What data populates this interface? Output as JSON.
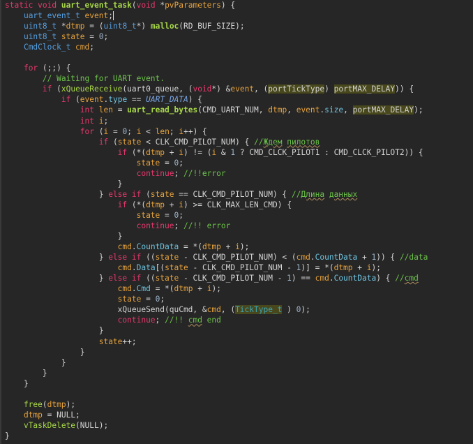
{
  "editor": {
    "lines": [
      [
        [
          "k",
          "static void "
        ],
        [
          "fb",
          "uart_event_task"
        ],
        [
          "p",
          "("
        ],
        [
          "k",
          "void "
        ],
        [
          "p",
          "*"
        ],
        [
          "v",
          "pvParameters"
        ],
        [
          "p",
          ") {"
        ]
      ],
      [
        [
          "p",
          "    "
        ],
        [
          "t",
          "uart_event_t "
        ],
        [
          "v",
          "event"
        ],
        [
          "p",
          "; cursor"
        ]
      ],
      [
        [
          "p",
          "    "
        ],
        [
          "t",
          "uint8_t "
        ],
        [
          "p",
          "*"
        ],
        [
          "v",
          "dtmp"
        ],
        [
          "p",
          " = ("
        ],
        [
          "t",
          "uint8_t"
        ],
        [
          "p",
          "*) "
        ],
        [
          "fb",
          "malloc"
        ],
        [
          "p",
          "(RD_BUF_SIZE);"
        ]
      ],
      [
        [
          "p",
          "    "
        ],
        [
          "t",
          "uint8_t "
        ],
        [
          "v",
          "state"
        ],
        [
          "p",
          " = "
        ],
        [
          "n",
          "0"
        ],
        [
          "p",
          ";"
        ]
      ],
      [
        [
          "p",
          "    "
        ],
        [
          "t",
          "CmdClock_t "
        ],
        [
          "v",
          "cmd"
        ],
        [
          "p",
          ";"
        ]
      ],
      [],
      [
        [
          "p",
          "    "
        ],
        [
          "k",
          "for"
        ],
        [
          "p",
          " (;;) {"
        ]
      ],
      [
        [
          "p",
          "        "
        ],
        [
          "c",
          "// Waiting for UART event."
        ]
      ],
      [
        [
          "p",
          "        "
        ],
        [
          "k",
          "if"
        ],
        [
          "p",
          " ("
        ],
        [
          "f",
          "xQueueReceive"
        ],
        [
          "p",
          "(uart0_queue, ("
        ],
        [
          "k",
          "void"
        ],
        [
          "p",
          "*) &"
        ],
        [
          "v",
          "event"
        ],
        [
          "p",
          ", ("
        ],
        [
          "h",
          "portTickType"
        ],
        [
          "p",
          ") "
        ],
        [
          "h",
          "portMAX_DELAY"
        ],
        [
          "p",
          ")) {"
        ]
      ],
      [
        [
          "p",
          "            "
        ],
        [
          "k",
          "if"
        ],
        [
          "p",
          " ("
        ],
        [
          "v",
          "event"
        ],
        [
          "p",
          "."
        ],
        [
          "fld",
          "type"
        ],
        [
          "p",
          " == "
        ],
        [
          "e",
          "UART_DATA"
        ],
        [
          "p",
          ") {"
        ]
      ],
      [
        [
          "p",
          "                "
        ],
        [
          "k",
          "int "
        ],
        [
          "v",
          "len"
        ],
        [
          "p",
          " = "
        ],
        [
          "fb",
          "uart_read_bytes"
        ],
        [
          "p",
          "(CMD_UART_NUM, "
        ],
        [
          "v",
          "dtmp"
        ],
        [
          "p",
          ", "
        ],
        [
          "v",
          "event"
        ],
        [
          "p",
          "."
        ],
        [
          "fld",
          "size"
        ],
        [
          "p",
          ", "
        ],
        [
          "h",
          "portMAX_DELAY"
        ],
        [
          "p",
          ");"
        ]
      ],
      [
        [
          "p",
          "                "
        ],
        [
          "k",
          "int "
        ],
        [
          "v",
          "i"
        ],
        [
          "p",
          ";"
        ]
      ],
      [
        [
          "p",
          "                "
        ],
        [
          "k",
          "for"
        ],
        [
          "p",
          " ("
        ],
        [
          "v",
          "i"
        ],
        [
          "p",
          " = "
        ],
        [
          "n",
          "0"
        ],
        [
          "p",
          "; "
        ],
        [
          "v",
          "i"
        ],
        [
          "p",
          " < "
        ],
        [
          "v",
          "len"
        ],
        [
          "p",
          "; "
        ],
        [
          "v",
          "i"
        ],
        [
          "p",
          "++) {"
        ]
      ],
      [
        [
          "p",
          "                    "
        ],
        [
          "k",
          "if"
        ],
        [
          "p",
          " ("
        ],
        [
          "v",
          "state"
        ],
        [
          "p",
          " < CLK_CMD_PILOT_NUM) { "
        ],
        [
          "c",
          "//"
        ],
        [
          "c sq",
          "Ждем"
        ],
        [
          "c",
          " "
        ],
        [
          "c sq",
          "пилотов"
        ]
      ],
      [
        [
          "p",
          "                        "
        ],
        [
          "k",
          "if"
        ],
        [
          "p",
          " (*("
        ],
        [
          "v",
          "dtmp"
        ],
        [
          "p",
          " + "
        ],
        [
          "v",
          "i"
        ],
        [
          "p",
          ") != ("
        ],
        [
          "v",
          "i"
        ],
        [
          "p",
          " & "
        ],
        [
          "n",
          "1"
        ],
        [
          "p",
          " ? CMD_CLCK_PILOT1 : CMD_CLCK_PILOT2)) {"
        ]
      ],
      [
        [
          "p",
          "                            "
        ],
        [
          "v",
          "state"
        ],
        [
          "p",
          " = "
        ],
        [
          "n",
          "0"
        ],
        [
          "p",
          ";"
        ]
      ],
      [
        [
          "p",
          "                            "
        ],
        [
          "k",
          "continue"
        ],
        [
          "p",
          "; "
        ],
        [
          "c",
          "//!!error"
        ]
      ],
      [
        [
          "p",
          "                        }"
        ]
      ],
      [
        [
          "p",
          "                    } "
        ],
        [
          "k",
          "else if"
        ],
        [
          "p",
          " ("
        ],
        [
          "v",
          "state"
        ],
        [
          "p",
          " == CLK_CMD_PILOT_NUM) { "
        ],
        [
          "c",
          "//"
        ],
        [
          "c sq",
          "Длина"
        ],
        [
          "c",
          " "
        ],
        [
          "c sq",
          "данных"
        ]
      ],
      [
        [
          "p",
          "                        "
        ],
        [
          "k",
          "if"
        ],
        [
          "p",
          " (*("
        ],
        [
          "v",
          "dtmp"
        ],
        [
          "p",
          " + "
        ],
        [
          "v",
          "i"
        ],
        [
          "p",
          ") >= CLK_MAX_LEN_CMD) {"
        ]
      ],
      [
        [
          "p",
          "                            "
        ],
        [
          "v",
          "state"
        ],
        [
          "p",
          " = "
        ],
        [
          "n",
          "0"
        ],
        [
          "p",
          ";"
        ]
      ],
      [
        [
          "p",
          "                            "
        ],
        [
          "k",
          "continue"
        ],
        [
          "p",
          "; "
        ],
        [
          "c",
          "//!! error"
        ]
      ],
      [
        [
          "p",
          "                        }"
        ]
      ],
      [
        [
          "p",
          "                        "
        ],
        [
          "v",
          "cmd"
        ],
        [
          "p",
          "."
        ],
        [
          "fld",
          "CountData"
        ],
        [
          "p",
          " = *("
        ],
        [
          "v",
          "dtmp"
        ],
        [
          "p",
          " + "
        ],
        [
          "v",
          "i"
        ],
        [
          "p",
          ");"
        ]
      ],
      [
        [
          "p",
          "                    } "
        ],
        [
          "k",
          "else if"
        ],
        [
          "p",
          " (("
        ],
        [
          "v",
          "state"
        ],
        [
          "p",
          " - CLK_CMD_PILOT_NUM) < ("
        ],
        [
          "v",
          "cmd"
        ],
        [
          "p",
          "."
        ],
        [
          "fld",
          "CountData"
        ],
        [
          "p",
          " + "
        ],
        [
          "n",
          "1"
        ],
        [
          "p",
          ")) { "
        ],
        [
          "c",
          "//data"
        ]
      ],
      [
        [
          "p",
          "                        "
        ],
        [
          "v",
          "cmd"
        ],
        [
          "p",
          "."
        ],
        [
          "fld",
          "Data"
        ],
        [
          "p",
          "[("
        ],
        [
          "v",
          "state"
        ],
        [
          "p",
          " - CLK_CMD_PILOT_NUM - "
        ],
        [
          "n",
          "1"
        ],
        [
          "p",
          ")] = *("
        ],
        [
          "v",
          "dtmp"
        ],
        [
          "p",
          " + "
        ],
        [
          "v",
          "i"
        ],
        [
          "p",
          ");"
        ]
      ],
      [
        [
          "p",
          "                    } "
        ],
        [
          "k",
          "else if"
        ],
        [
          "p",
          " (("
        ],
        [
          "v",
          "state"
        ],
        [
          "p",
          " - CLK_CMD_PILOT_NUM - "
        ],
        [
          "n",
          "1"
        ],
        [
          "p",
          ") == "
        ],
        [
          "v",
          "cmd"
        ],
        [
          "p",
          "."
        ],
        [
          "fld",
          "CountData"
        ],
        [
          "p",
          ") { "
        ],
        [
          "c",
          "//"
        ],
        [
          "c sq",
          "cmd"
        ]
      ],
      [
        [
          "p",
          "                        "
        ],
        [
          "v",
          "cmd"
        ],
        [
          "p",
          "."
        ],
        [
          "fld",
          "Cmd"
        ],
        [
          "p",
          " = *("
        ],
        [
          "v",
          "dtmp"
        ],
        [
          "p",
          " + "
        ],
        [
          "v",
          "i"
        ],
        [
          "p",
          ");"
        ]
      ],
      [
        [
          "p",
          "                        "
        ],
        [
          "v",
          "state"
        ],
        [
          "p",
          " = "
        ],
        [
          "n",
          "0"
        ],
        [
          "p",
          ";"
        ]
      ],
      [
        [
          "p",
          "                        xQueueSend(quCmd, &"
        ],
        [
          "v",
          "cmd"
        ],
        [
          "p",
          ", ("
        ],
        [
          "ht",
          "TickType_t"
        ],
        [
          "p",
          " ) "
        ],
        [
          "n",
          "0"
        ],
        [
          "p",
          ");"
        ]
      ],
      [
        [
          "p",
          "                        "
        ],
        [
          "k",
          "continue"
        ],
        [
          "p",
          "; "
        ],
        [
          "c",
          "//!! "
        ],
        [
          "c sq",
          "cmd"
        ],
        [
          "c",
          " end"
        ]
      ],
      [
        [
          "p",
          "                    }"
        ]
      ],
      [
        [
          "p",
          "                    "
        ],
        [
          "v",
          "state"
        ],
        [
          "p",
          "++;"
        ]
      ],
      [
        [
          "p",
          "                }"
        ]
      ],
      [
        [
          "p",
          "            }"
        ]
      ],
      [
        [
          "p",
          "        }"
        ]
      ],
      [
        [
          "p",
          "    }"
        ]
      ],
      [],
      [
        [
          "p",
          "    "
        ],
        [
          "f",
          "free"
        ],
        [
          "p",
          "("
        ],
        [
          "v",
          "dtmp"
        ],
        [
          "p",
          ");"
        ]
      ],
      [
        [
          "p",
          "    "
        ],
        [
          "v",
          "dtmp"
        ],
        [
          "p",
          " = NULL;"
        ]
      ],
      [
        [
          "p",
          "    "
        ],
        [
          "f",
          "vTaskDelete"
        ],
        [
          "p",
          "(NULL);"
        ]
      ],
      [
        [
          "p",
          "}"
        ]
      ]
    ]
  }
}
